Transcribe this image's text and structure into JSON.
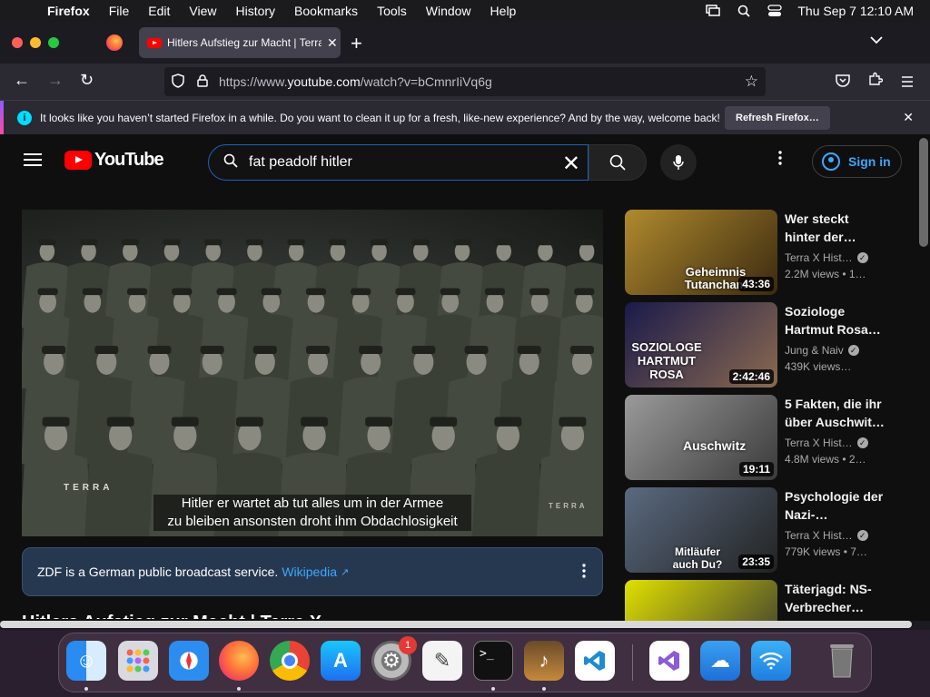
{
  "menubar": {
    "app": "Firefox",
    "items": [
      "File",
      "Edit",
      "View",
      "History",
      "Bookmarks",
      "Tools",
      "Window",
      "Help"
    ],
    "clock": "Thu Sep 7  12:10 AM"
  },
  "browser": {
    "tab_title": "Hitlers Aufstieg zur Macht | Terra X",
    "url_prefix": "https://www.",
    "url_domain": "youtube.com",
    "url_path": "/watch?v=bCmnrIiVq6g",
    "notification": "It looks like you haven’t started Firefox in a while. Do you want to clean it up for a fresh, like-new experience? And by the way, welcome back!",
    "refresh_label": "Refresh Firefox…"
  },
  "youtube": {
    "logo_text": "YouTube",
    "search_value": "fat peadolf hitler",
    "signin_label": "Sign in",
    "caption_line1": "Hitler er wartet ab tut alles um in der Armee",
    "caption_line2": "zu bleiben ansonsten droht ihm Obdachlosigkeit",
    "watermark_left": "TERRA",
    "watermark_right": "TERRA",
    "info_text": "ZDF is a German public broadcast service.",
    "info_link": "Wikipedia",
    "partial_title": "Hitlers Aufstieg zur Macht | Terra X",
    "related": [
      {
        "title": "Wer steckt hinter der…",
        "channel": "Terra X Hist…",
        "verified": true,
        "views": "2.2M views  • 1…",
        "duration": "43:36",
        "thumb_text": "Geheimnis Tutancham",
        "color_a": "#b08a2e",
        "color_b": "#3a2a10"
      },
      {
        "title": "Soziologe Hartmut Rosa…",
        "channel": "Jung & Naiv",
        "verified": true,
        "views": "439K views…",
        "duration": "2:42:46",
        "thumb_text": "SOZIOLOGE HARTMUT ROSA",
        "color_a": "#1a1a4a",
        "color_b": "#8a6a50"
      },
      {
        "title": "5 Fakten, die ihr über Auschwit…",
        "channel": "Terra X Hist…",
        "verified": true,
        "views": "4.8M views  • 2…",
        "duration": "19:11",
        "thumb_text": "Auschwitz",
        "color_a": "#9a9a9a",
        "color_b": "#3a3a3a"
      },
      {
        "title": "Psychologie der Nazi-…",
        "channel": "Terra X Hist…",
        "verified": true,
        "views": "779K views  • 7…",
        "duration": "23:35",
        "thumb_text": "Mitläufer auch Du?",
        "color_a": "#5a6a80",
        "color_b": "#222"
      },
      {
        "title": "Täterjagd: NS-Verbrecher…",
        "channel": "",
        "verified": false,
        "views": "",
        "duration": "",
        "thumb_text": "",
        "color_a": "#e0e000",
        "color_b": "#333"
      }
    ]
  }
}
